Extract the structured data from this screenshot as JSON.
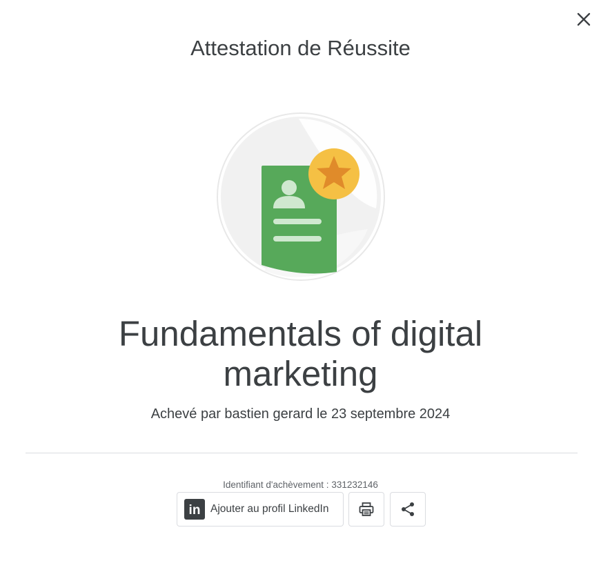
{
  "dialog": {
    "heading": "Attestation de Réussite",
    "course_title": "Fundamentals of digital marketing",
    "completion_line": "Achevé par bastien gerard le 23 septembre 2024",
    "credential": {
      "label": "Identifiant d'achèvement",
      "value": "331232146"
    },
    "actions": {
      "linkedin_label": "Ajouter au profil LinkedIn",
      "linkedin_logo_text": "in"
    }
  },
  "icons": {
    "close": "close-icon",
    "badge": "certificate-badge-icon",
    "linkedin": "linkedin-icon",
    "print": "print-icon",
    "share": "share-icon"
  },
  "colors": {
    "text": "#3c4043",
    "badge_green": "#57a95a",
    "badge_star_circle": "#f5c044",
    "badge_star": "#e08b2a",
    "divider": "#dadce0"
  }
}
